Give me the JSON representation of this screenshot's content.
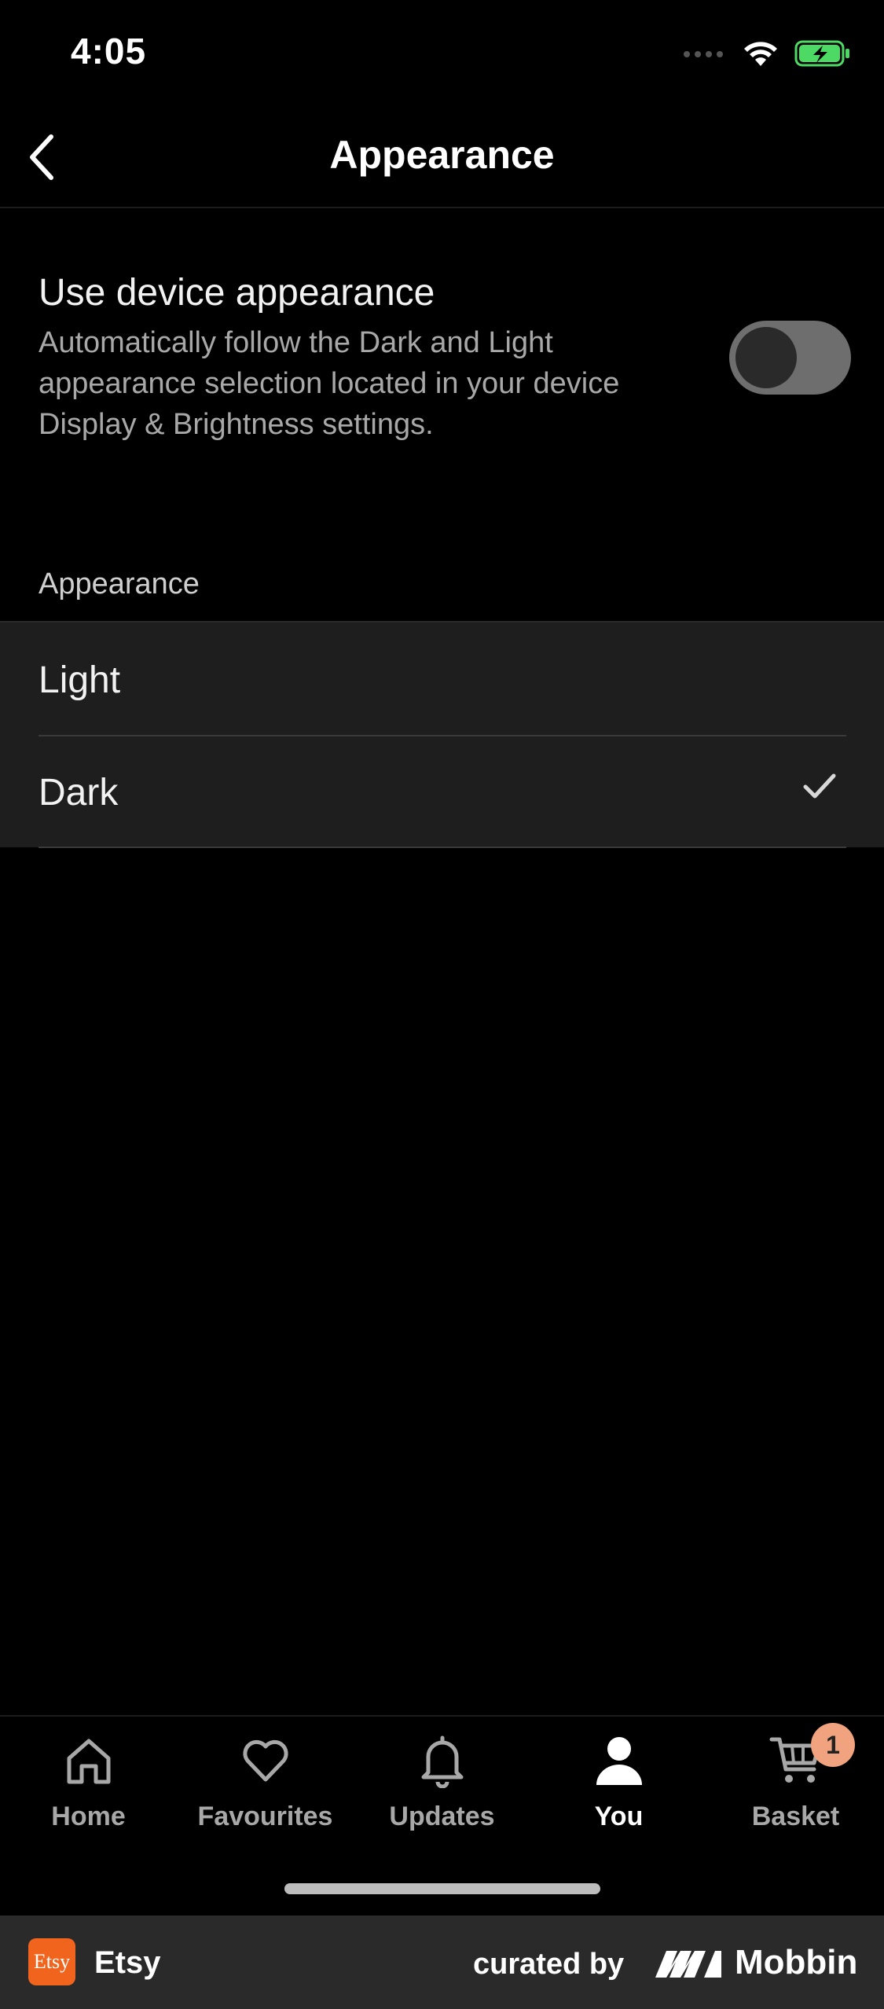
{
  "status_bar": {
    "time": "4:05"
  },
  "nav": {
    "title": "Appearance"
  },
  "device_setting": {
    "title": "Use device appearance",
    "description": "Automatically follow the Dark and Light appearance selection located in your device Display & Brightness settings.",
    "enabled": false
  },
  "appearance_section": {
    "header": "Appearance",
    "options": [
      {
        "label": "Light",
        "selected": false
      },
      {
        "label": "Dark",
        "selected": true
      }
    ]
  },
  "tab_bar": {
    "tabs": [
      {
        "label": "Home",
        "icon": "home-icon"
      },
      {
        "label": "Favourites",
        "icon": "heart-icon"
      },
      {
        "label": "Updates",
        "icon": "bell-icon"
      },
      {
        "label": "You",
        "icon": "person-icon",
        "active": true
      },
      {
        "label": "Basket",
        "icon": "cart-icon"
      }
    ],
    "basket_badge": "1"
  },
  "footer": {
    "app_logo_text": "Etsy",
    "app_name": "Etsy",
    "curated_by": "curated by",
    "brand": "Mobbin"
  },
  "colors": {
    "background": "#000000",
    "list_background": "#1e1e1e",
    "badge": "#f1a27e",
    "etsy_orange": "#f1641e",
    "battery_green": "#4cd964"
  }
}
